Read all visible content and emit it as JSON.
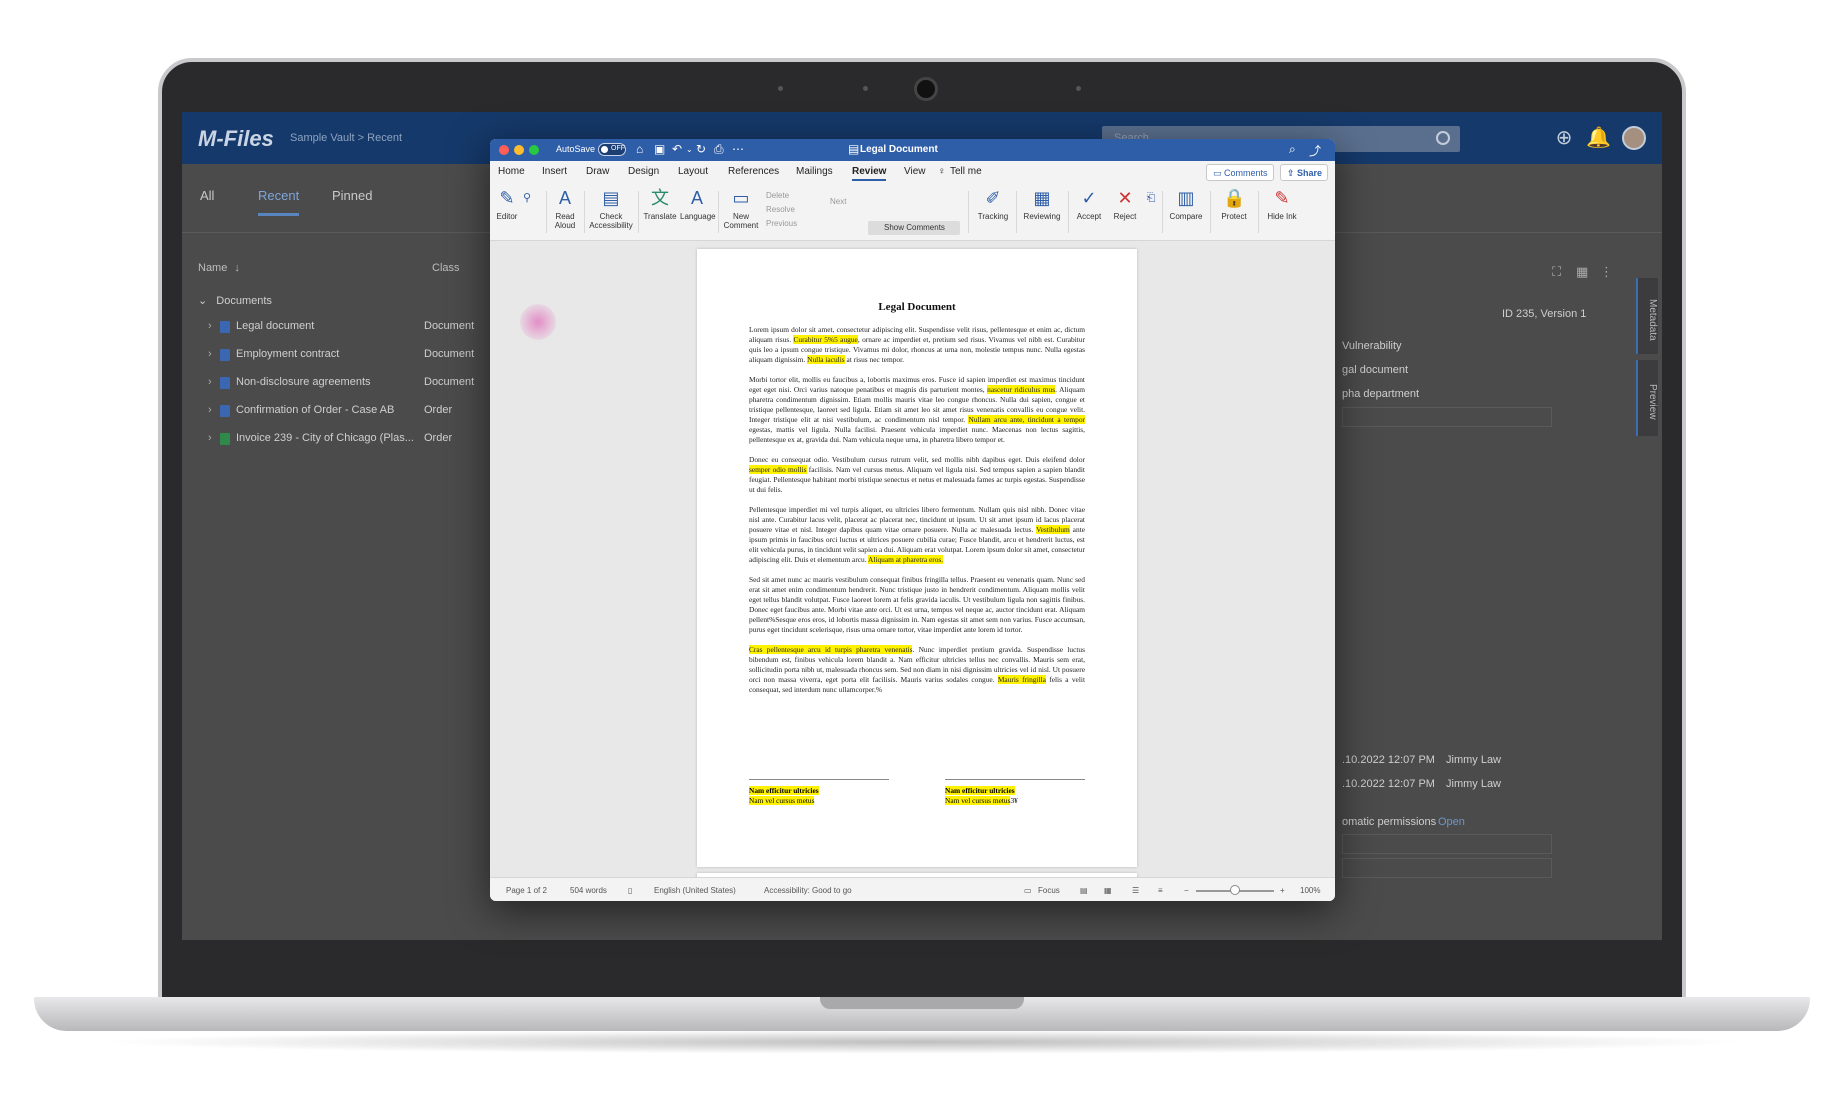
{
  "mfiles": {
    "logo": "M-Files",
    "breadcrumb": "Sample Vault > Recent",
    "search_placeholder": "Search",
    "tabs": [
      "All",
      "Recent",
      "Pinned"
    ],
    "columns": {
      "name": "Name",
      "class": "Class"
    },
    "group": "Documents",
    "rows": [
      {
        "name": "Legal document",
        "class": "Document"
      },
      {
        "name": "Employment contract",
        "class": "Document"
      },
      {
        "name": "Non-disclosure agreements",
        "class": "Document"
      },
      {
        "name": "Confirmation of Order - Case AB",
        "class": "Order"
      },
      {
        "name": "Invoice 239 - City of Chicago (Plas...",
        "class": "Order"
      }
    ],
    "right": {
      "id_version": "ID 235, Version 1",
      "prop1": "Vulnerability",
      "prop2": "gal document",
      "prop3": "pha department",
      "hist1_date": ".10.2022 12:07 PM",
      "hist1_user": "Jimmy Law",
      "hist2_date": ".10.2022 12:07 PM",
      "hist2_user": "Jimmy Law",
      "permissions": "omatic permissions",
      "open_link": "Open",
      "side_tab_metadata": "Metadata",
      "side_tab_preview": "Preview"
    }
  },
  "word": {
    "autosave_label": "AutoSave",
    "autosave_state": "OFF",
    "title": "Legal Document",
    "menu": [
      "Home",
      "Insert",
      "Draw",
      "Design",
      "Layout",
      "References",
      "Mailings",
      "Review",
      "View",
      "Tell me"
    ],
    "active_menu": "Review",
    "comments_btn": "Comments",
    "share_btn": "Share",
    "ribbon": {
      "editor": "Editor",
      "read_aloud": [
        "Read",
        "Aloud"
      ],
      "check_accessibility": [
        "Check",
        "Accessibility"
      ],
      "translate": "Translate",
      "language": "Language",
      "new_comment": [
        "New",
        "Comment"
      ],
      "delete": "Delete",
      "resolve": "Resolve",
      "previous": "Previous",
      "next": "Next",
      "show_comments": "Show Comments",
      "tracking": "Tracking",
      "reviewing": "Reviewing",
      "accept": "Accept",
      "reject": "Reject",
      "compare": "Compare",
      "protect": "Protect",
      "hide_ink": "Hide Ink"
    },
    "doc": {
      "heading": "Legal Document",
      "p1": [
        "Lorem ipsum dolor sit amet, consectetur adipiscing elit. Suspendisse velit risus, pellentesque et enim ac, dictum aliquam risus. ",
        "Curabitur 5%5 augue",
        ", ornare ac imperdiet et, pretium sed risus. Vivamus vel nibh est. Curabitur quis leo a ipsum congue tristique. Vivamus mi dolor, rhoncus at urna non, molestie tempus nunc. Nulla egestas aliquam dignissim. ",
        "Nulla iaculis",
        " at risus nec tempor."
      ],
      "p2": [
        "Morbi tortor elit, mollis eu faucibus a, lobortis maximus eros. Fusce id sapien imperdiet est maximus tincidunt eget eget nisi. Orci varius natoque penatibus et magnis dis parturient montes, ",
        "nascetur ridiculus mus",
        ". Aliquam pharetra condimentum dignissim. Etiam mollis mauris vitae leo congue rhoncus. Nulla dui sapien, congue et tristique pellentesque, laoreet sed ligula. Etiam sit amet leo sit amet risus venenatis convallis eu congue velit. Integer tristique elit at nisi vestibulum, ac condimentum nisl tempor. ",
        "Nullam arcu ante, tincidunt a tempor",
        " egestas, mattis vel ligula. Nulla facilisi. Praesent vehicula imperdiet nunc. Maecenas non lectus sagittis, pellentesque ex at, gravida dui. Nam vehicula neque urna, in pharetra libero tempor et."
      ],
      "p3": [
        "Donec eu consequat odio. Vestibulum cursus rutrum velit, sed mollis nibh dapibus eget. Duis eleifend dolor ",
        "semper odio mollis",
        " facilisis. Nam vel cursus metus. Aliquam vel ligula nisi. Sed tempus sapien a sapien blandit feugiat. Pellentesque habitant morbi tristique senectus et netus et malesuada fames ac turpis egestas. Suspendisse ut dui felis."
      ],
      "p4": [
        "Pellentesque imperdiet mi vel turpis aliquet, eu ultricies libero fermentum. Nullam quis nisl nibh. Donec vitae nisl ante. Curabitur lacus velit, placerat ac placerat nec, tincidunt ut ipsum. Ut sit amet ipsum id lacus placerat posuere vitae et nisl. Integer dapibus quam vitae ornare posuere. Nulla ac malesuada lectus. ",
        "Vestibulum",
        " ante ipsum primis in faucibus orci luctus et ultrices posuere cubilia curae; Fusce blandit, arcu et hendrerit luctus, est elit vehicula purus, in tincidunt velit sapien a dui. Aliquam erat volutpat. Lorem ipsum dolor sit amet, consectetur adipiscing elit. Duis et elementum arcu. ",
        "Aliquam at pharetra eros."
      ],
      "p5": "Sed sit amet nunc ac mauris vestibulum consequat finibus fringilla tellus. Praesent eu venenatis quam. Nunc sed erat sit amet enim condimentum hendrerit. Nunc tristique justo in hendrerit condimentum. Aliquam mollis velit eget tellus blandit volutpat. Fusce laoreet lorem at felis gravida iaculis. Ut vestibulum ligula non sagittis finibus. Donec eget faucibus ante. Morbi vitae ante orci. Ut est urna, tempus vel neque ac, auctor tincidunt erat. Aliquam pellent%Sesque eros eros, id lobortis massa dignissim in. Nam egestas sit amet sem non varius. Fusce accumsan, purus eget tincidunt scelerisque, risus urna ornare tortor, vitae imperdiet ante lorem id tortor.",
      "p6": [
        "Cras pellentesque arcu id turpis pharetra venenatis",
        ". Nunc imperdiet pretium gravida. Suspendisse luctus bibendum est, finibus vehicula lorem blandit a. Nam efficitur ultricies tellus nec convallis. Mauris sem erat, sollicitudin porta nibh ut, malesuada rhoncus sem. Sed non diam in nisi dignissim ultricies vel id nisl. Ut posuere orci non massa viverra, eget porta elit facilisis. Mauris varius sodales congue. ",
        "Mauris fringilla",
        " felis a velit consequat, sed interdum nunc ullamcorper.%"
      ],
      "sig_left": [
        "Nam efficitur ultricies",
        "Nam vel cursus metus"
      ],
      "sig_right": [
        "Nam efficitur ultricies",
        "Nam vel cursus metus"
      ],
      "sig_right_suffix": "3¥"
    },
    "status": {
      "page": "Page 1 of 2",
      "words": "504 words",
      "language": "English (United States)",
      "accessibility": "Accessibility: Good to go",
      "focus": "Focus",
      "zoom": "100%"
    }
  }
}
